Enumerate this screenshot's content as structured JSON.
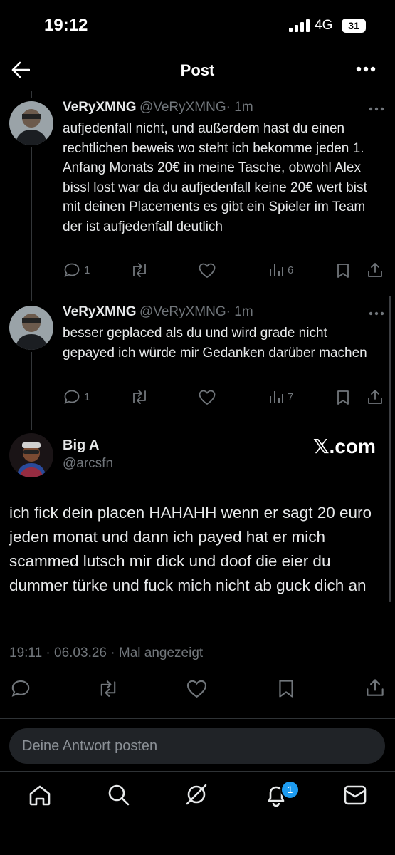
{
  "status_bar": {
    "time": "19:12",
    "network": "4G",
    "battery": "31"
  },
  "header": {
    "title": "Post"
  },
  "replies": [
    {
      "name": "VeRyXMNG",
      "handle": "@VeRyXMNG",
      "time": "· 1m",
      "text": "aufjedenfall nicht, und außerdem hast du einen rechtlichen beweis wo steht ich bekomme jeden 1. Anfang Monats 20€ in meine Tasche, obwohl Alex bissl lost war da du aufjedenfall keine 20€ wert bist mit deinen Placements es gibt ein Spieler im Team der ist aufjedenfall deutlich",
      "reply_count": "1",
      "views": "6"
    },
    {
      "name": "VeRyXMNG",
      "handle": "@VeRyXMNG",
      "time": "· 1m",
      "text": "besser geplaced als du und wird grade nicht gepayed ich würde mir Gedanken darüber machen",
      "reply_count": "1",
      "views": "7"
    }
  ],
  "main_post": {
    "name": "Big A",
    "handle": "@arcsfn",
    "watermark": "𝕏.com",
    "text": "ich fick dein placen HAHAHH wenn er sagt 20 euro jeden monat und dann ich payed hat er mich scammed lutsch mir dick und doof die eier du dummer türke und fuck mich nicht ab guck dich an",
    "meta": "19:11 · 06.03.26 · Mal angezeigt"
  },
  "reply_input": {
    "placeholder": "Deine Antwort posten"
  },
  "bottom_nav": {
    "notifications_badge": "1"
  },
  "icons": [
    "back-arrow-icon",
    "more-icon",
    "reply-icon",
    "repost-icon",
    "like-icon",
    "views-icon",
    "bookmark-icon",
    "share-icon",
    "home-icon",
    "search-icon",
    "grok-icon",
    "bell-icon",
    "mail-icon"
  ]
}
